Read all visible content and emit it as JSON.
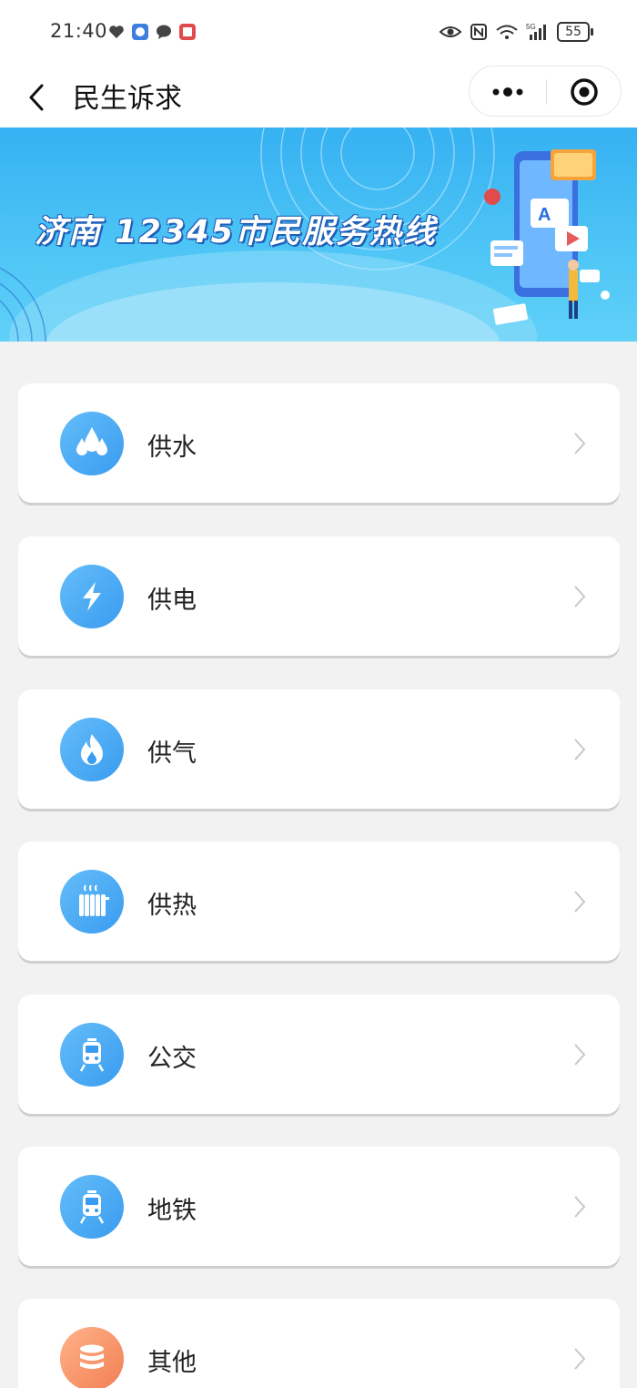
{
  "status_bar": {
    "time": "21:40",
    "battery": "55",
    "network": "5G"
  },
  "nav": {
    "title": "民生诉求"
  },
  "banner": {
    "title": "济南 12345市民服务热线"
  },
  "services": [
    {
      "label": "供水",
      "icon": "water-drops-icon"
    },
    {
      "label": "供电",
      "icon": "lightning-icon"
    },
    {
      "label": "供气",
      "icon": "flame-icon"
    },
    {
      "label": "供热",
      "icon": "radiator-icon"
    },
    {
      "label": "公交",
      "icon": "train-icon"
    },
    {
      "label": "地铁",
      "icon": "train-icon"
    },
    {
      "label": "其他",
      "icon": "database-icon"
    }
  ],
  "colors": {
    "accent_blue": "#3a9cf0",
    "accent_orange": "#f27e53",
    "background": "#f2f2f2"
  }
}
